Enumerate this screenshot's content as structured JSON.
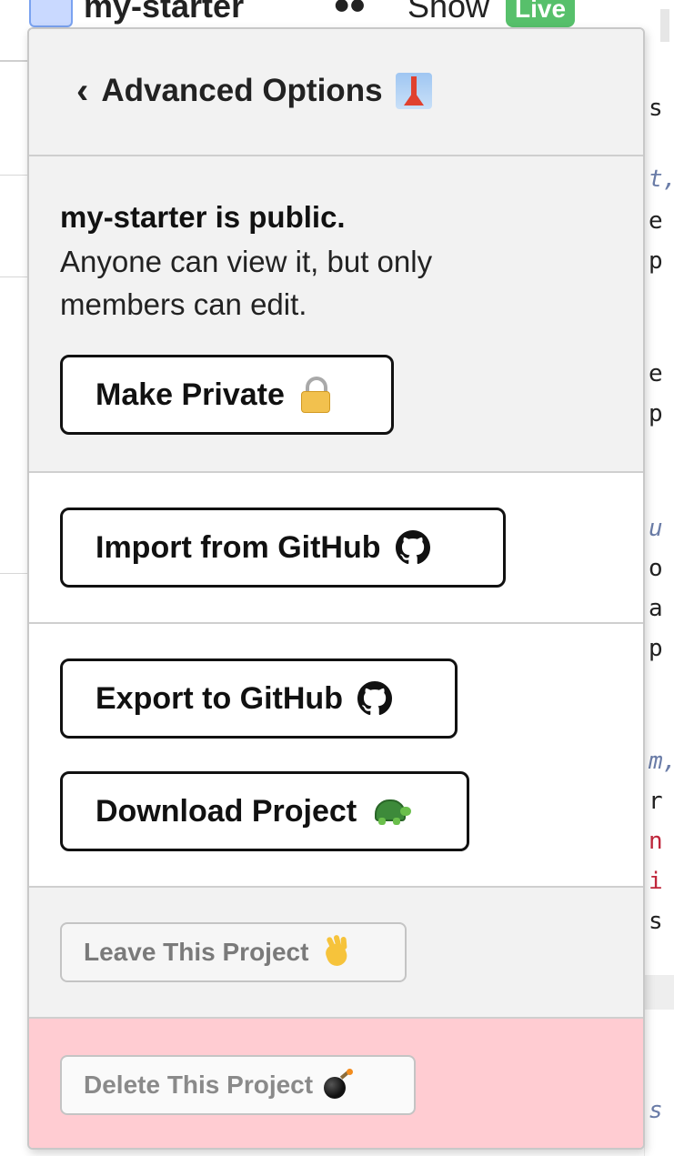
{
  "topbar": {
    "project_name": "my-starter",
    "show_icon": "sunglasses-icon",
    "show_label": "Show",
    "live_badge": "Live"
  },
  "code_peek": {
    "chars": [
      "s",
      "t,",
      "e",
      "p",
      "e",
      "p",
      "u",
      "o",
      "a",
      "p",
      "m,",
      "r",
      "n",
      "i",
      "s",
      "s"
    ]
  },
  "popover": {
    "header": {
      "back_icon": "chevron-left-icon",
      "title": "Advanced Options",
      "title_icon": "tokyo-tower-icon"
    },
    "privacy": {
      "heading": "my-starter is public.",
      "description": "Anyone can view it, but only members can edit.",
      "make_private_label": "Make Private",
      "make_private_icon": "lock-icon"
    },
    "import": {
      "label": "Import from GitHub",
      "icon": "github-icon"
    },
    "export": {
      "export_label": "Export to GitHub",
      "export_icon": "github-icon",
      "download_label": "Download Project",
      "download_icon": "turtle-icon"
    },
    "leave": {
      "label": "Leave This Project",
      "icon": "waving-hand-icon"
    },
    "delete": {
      "label": "Delete This Project",
      "icon": "bomb-icon"
    }
  },
  "colors": {
    "popover_bg": "#f2f2f2",
    "danger_bg": "#ffccd2",
    "live_badge": "#57c06b",
    "button_border": "#111111"
  }
}
